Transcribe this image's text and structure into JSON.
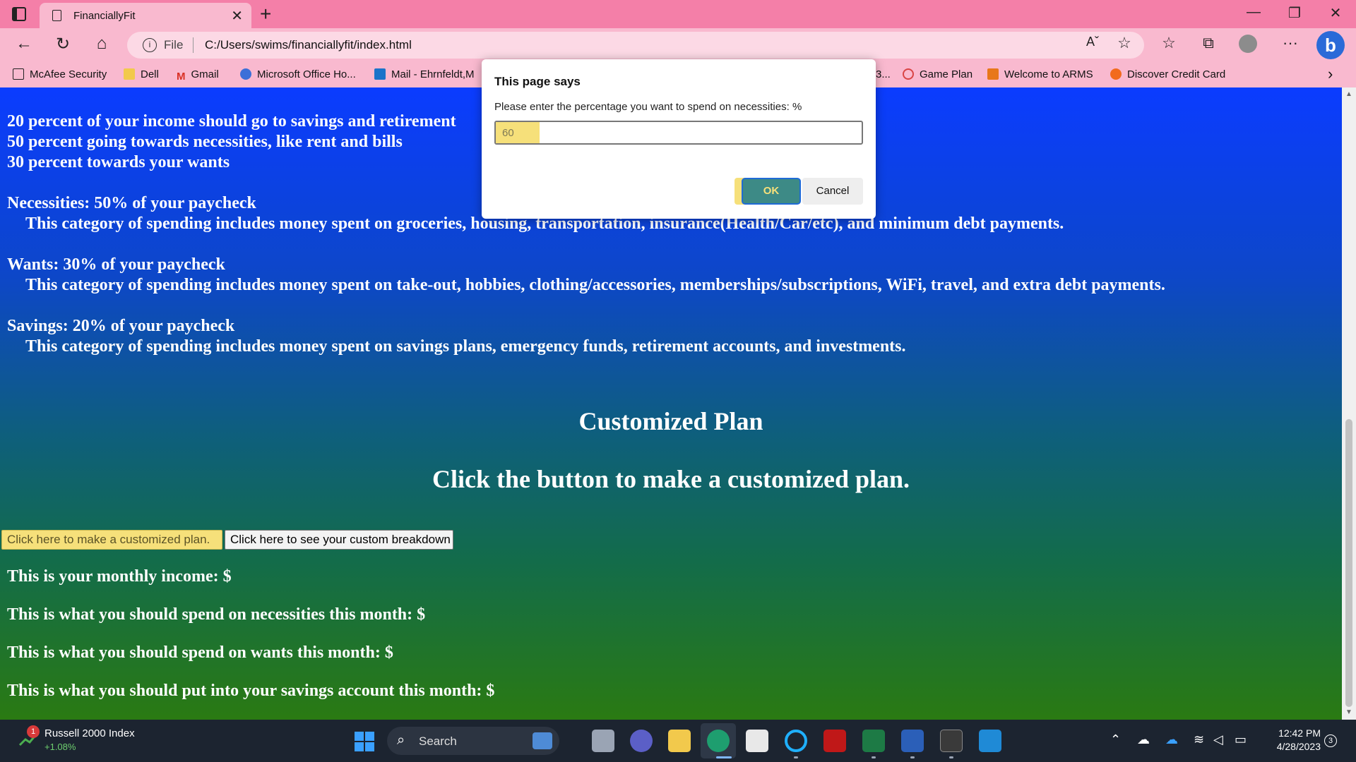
{
  "browser": {
    "tab_title": "FinanciallyFit",
    "omnibox_scheme": "File",
    "url": "C:/Users/swims/financiallyfit/index.html"
  },
  "bookmarks": [
    {
      "label": "McAfee Security",
      "icon": "page-icon",
      "color": "#ffffff"
    },
    {
      "label": "Dell",
      "icon": "folder-icon",
      "color": "#f2c94c"
    },
    {
      "label": "Gmail",
      "icon": "gmail-icon",
      "color": "#d93025"
    },
    {
      "label": "Microsoft Office Ho...",
      "icon": "office-icon",
      "color": "#3b6fd8"
    },
    {
      "label": "Mail - Ehrnfeldt,M",
      "icon": "outlook-icon",
      "color": "#1a73c9"
    },
    {
      "label": "3...",
      "icon": "hidden-icon",
      "color": "#f9b9cf"
    },
    {
      "label": "Game Plan",
      "icon": "game-plan-icon",
      "color": "#d94444"
    },
    {
      "label": "Welcome to ARMS",
      "icon": "arms-icon",
      "color": "#e8771a"
    },
    {
      "label": "Discover Credit Card",
      "icon": "discover-icon",
      "color": "#f26b1d"
    }
  ],
  "content": {
    "rule_lines": [
      "20 percent of your income should go to savings and retirement",
      "50 percent going towards necessities, like rent and bills",
      "30 percent towards your wants"
    ],
    "categories": [
      {
        "heading": "Necessities: 50% of your paycheck",
        "desc": "This category of spending includes money spent on groceries, housing, transportation, insurance(Health/Car/etc), and minimum debt payments."
      },
      {
        "heading": "Wants: 30% of your paycheck",
        "desc": "This category of spending includes money spent on take-out, hobbies, clothing/accessories, memberships/subscriptions, WiFi, travel, and extra debt payments."
      },
      {
        "heading": "Savings: 20% of your paycheck",
        "desc": "This category of spending includes money spent on savings plans, emergency funds, retirement accounts, and investments."
      }
    ],
    "plan_title": "Customized Plan",
    "plan_subtitle": "Click the button to make a customized plan.",
    "button_make_plan": "Click here to make a customized plan.",
    "button_breakdown": "Click here to see your custom breakdown",
    "results": [
      "This is your monthly income: $",
      "This is what you should spend on necessities this month: $",
      "This is what you should spend on wants this month: $",
      "This is what you should put into your savings account this month: $"
    ]
  },
  "dialog": {
    "title": "This page says",
    "message": "Please enter the percentage you want to spend on necessities: %",
    "input_value": "60",
    "ok_label": "OK",
    "cancel_label": "Cancel"
  },
  "taskbar": {
    "widget_badge": "1",
    "widget_name": "Russell 2000 Index",
    "widget_value": "+1.08%",
    "search_placeholder": "Search",
    "time": "12:42 PM",
    "date": "4/28/2023",
    "notification_count": "3"
  },
  "colors": {
    "chrome": "#f47fa8",
    "highlight": "#f6e07a",
    "page_top": "#0b3cff",
    "page_bottom": "#2a7a12"
  }
}
